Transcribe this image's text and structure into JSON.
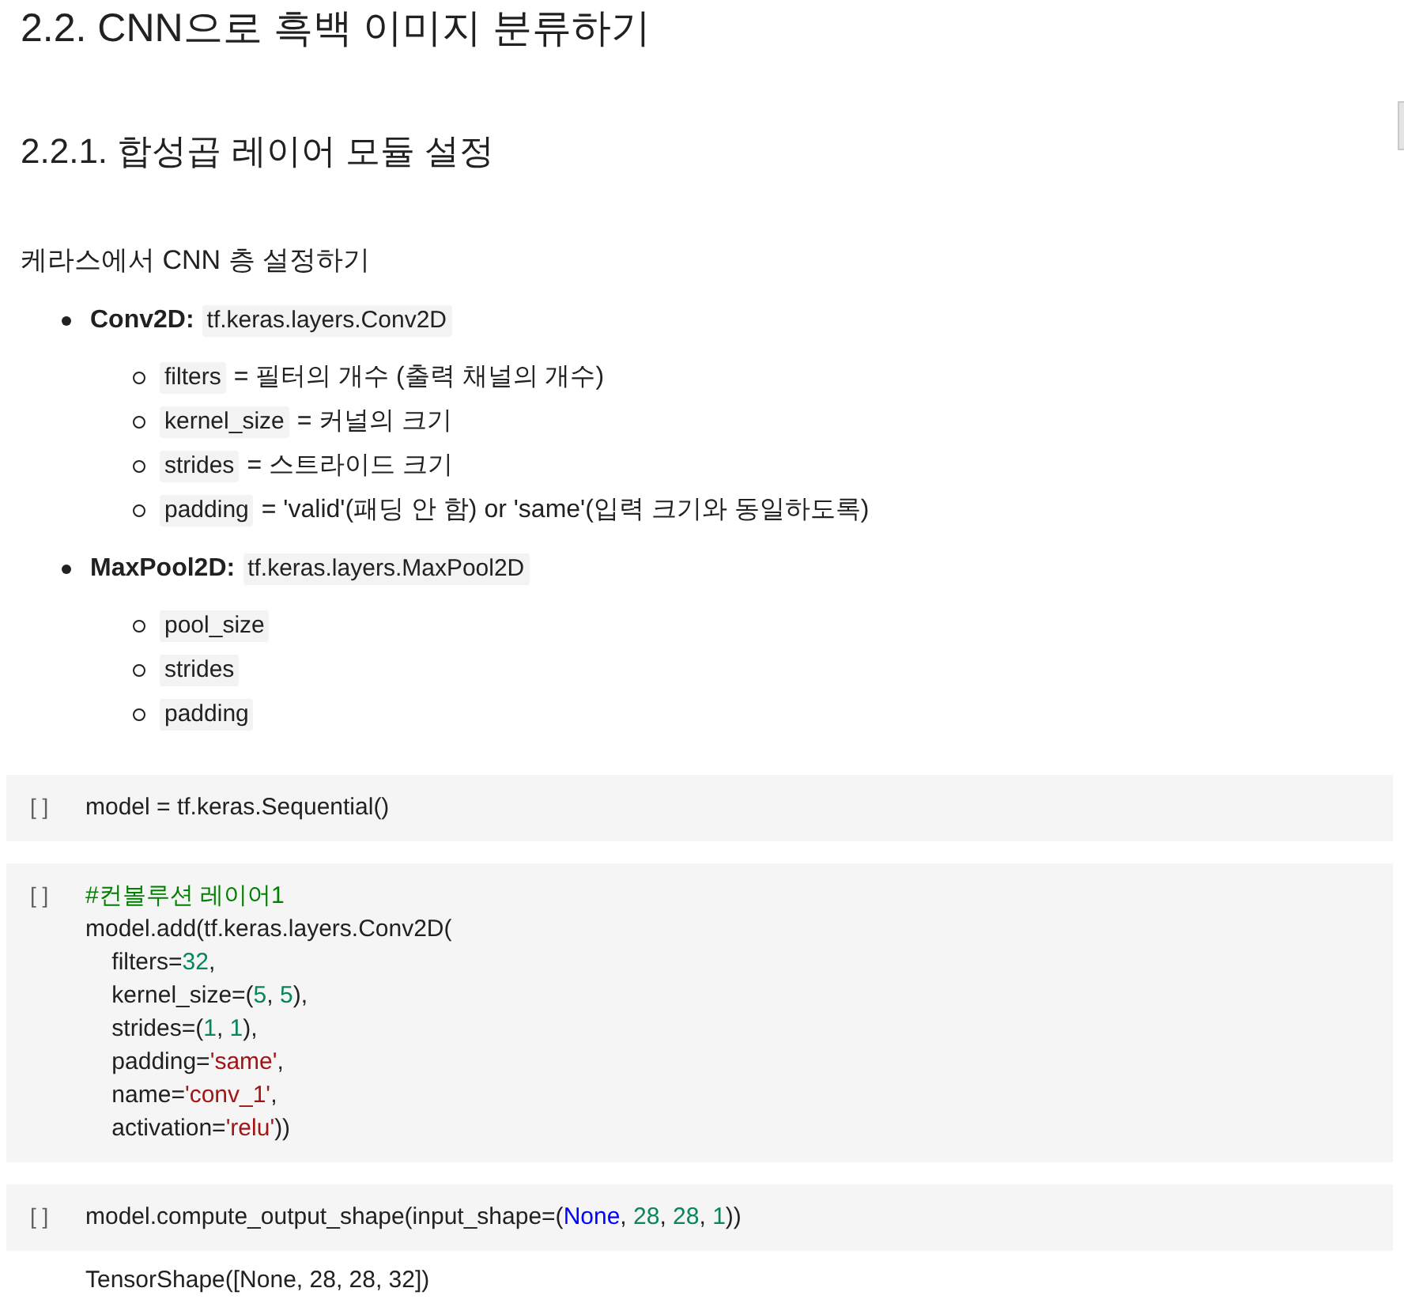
{
  "heading": "2.2. CNN으로 흑백 이미지 분류하기",
  "subheading": "2.2.1. 합성곱 레이어 모듈 설정",
  "intro": "케라스에서 CNN 층 설정하기",
  "layers": [
    {
      "label": "Conv2D:",
      "code": "tf.keras.layers.Conv2D",
      "children": [
        {
          "code": "filters",
          "text": "= 필터의 개수 (출력 채널의 개수)"
        },
        {
          "code": "kernel_size",
          "text": "= 커널의 크기"
        },
        {
          "code": "strides",
          "text": "= 스트라이드 크기"
        },
        {
          "code": "padding",
          "text": "= 'valid'(패딩 안 함) or 'same'(입력 크기와 동일하도록)"
        }
      ]
    },
    {
      "label": "MaxPool2D:",
      "code": "tf.keras.layers.MaxPool2D",
      "children": [
        {
          "code": "pool_size"
        },
        {
          "code": "strides"
        },
        {
          "code": "padding"
        }
      ]
    }
  ],
  "cells": [
    {
      "prompt": "[ ]",
      "lines": [
        [
          {
            "kind": "plain",
            "text": "model = tf.keras.Sequential()"
          }
        ]
      ]
    },
    {
      "prompt": "[ ]",
      "lines": [
        [
          {
            "kind": "comment",
            "text": "#컨볼루션 레이어1"
          }
        ],
        [
          {
            "kind": "plain",
            "text": "model.add(tf.keras.layers.Conv2D("
          }
        ],
        [
          {
            "kind": "plain",
            "text": "    filters="
          },
          {
            "kind": "number",
            "text": "32"
          },
          {
            "kind": "plain",
            "text": ","
          }
        ],
        [
          {
            "kind": "plain",
            "text": "    kernel_size=("
          },
          {
            "kind": "number",
            "text": "5"
          },
          {
            "kind": "plain",
            "text": ", "
          },
          {
            "kind": "number",
            "text": "5"
          },
          {
            "kind": "plain",
            "text": "),"
          }
        ],
        [
          {
            "kind": "plain",
            "text": "    strides=("
          },
          {
            "kind": "number",
            "text": "1"
          },
          {
            "kind": "plain",
            "text": ", "
          },
          {
            "kind": "number",
            "text": "1"
          },
          {
            "kind": "plain",
            "text": "),"
          }
        ],
        [
          {
            "kind": "plain",
            "text": "    padding="
          },
          {
            "kind": "string",
            "text": "'same'"
          },
          {
            "kind": "plain",
            "text": ","
          }
        ],
        [
          {
            "kind": "plain",
            "text": "    name="
          },
          {
            "kind": "string",
            "text": "'conv_1'"
          },
          {
            "kind": "plain",
            "text": ","
          }
        ],
        [
          {
            "kind": "plain",
            "text": "    activation="
          },
          {
            "kind": "string",
            "text": "'relu'"
          },
          {
            "kind": "plain",
            "text": "))"
          }
        ]
      ]
    },
    {
      "prompt": "[ ]",
      "lines": [
        [
          {
            "kind": "plain",
            "text": "model.compute_output_shape(input_shape=("
          },
          {
            "kind": "keyword",
            "text": "None"
          },
          {
            "kind": "plain",
            "text": ", "
          },
          {
            "kind": "number",
            "text": "28"
          },
          {
            "kind": "plain",
            "text": ", "
          },
          {
            "kind": "number",
            "text": "28"
          },
          {
            "kind": "plain",
            "text": ", "
          },
          {
            "kind": "number",
            "text": "1"
          },
          {
            "kind": "plain",
            "text": "))"
          }
        ]
      ],
      "output": "TensorShape([None, 28, 28, 32])"
    }
  ]
}
